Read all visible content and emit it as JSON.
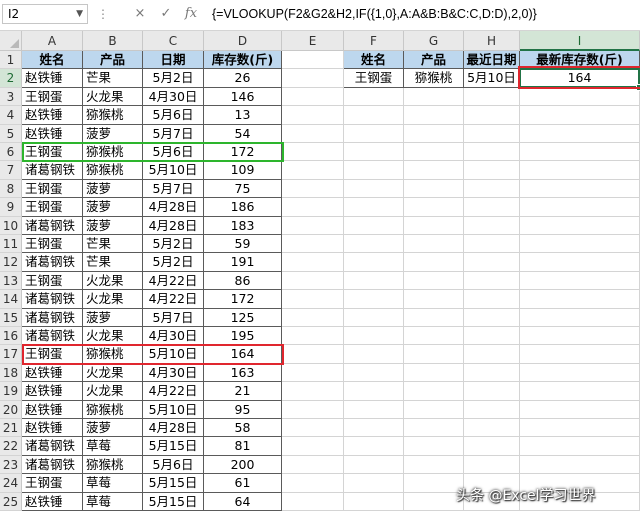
{
  "formula_bar": {
    "name_box": "I2",
    "cancel_icon": "×",
    "enter_icon": "✓",
    "fx_icon": "fx",
    "formula": "{=VLOOKUP(F2&G2&H2,IF({1,0},A:A&B:B&C:C,D:D),2,0)}"
  },
  "columns": [
    "A",
    "B",
    "C",
    "D",
    "E",
    "F",
    "G",
    "H",
    "I"
  ],
  "selected_column": "I",
  "row_numbers": [
    "1",
    "2",
    "3",
    "4",
    "5",
    "6",
    "7",
    "8",
    "9",
    "10",
    "11",
    "12",
    "13",
    "14",
    "15",
    "16",
    "17",
    "18",
    "19",
    "20",
    "21",
    "22",
    "23",
    "24",
    "25"
  ],
  "source_table": {
    "headers": [
      "姓名",
      "产品",
      "日期",
      "库存数(斤)"
    ],
    "rows": [
      [
        "赵铁锤",
        "芒果",
        "5月2日",
        "26"
      ],
      [
        "王钢蛋",
        "火龙果",
        "4月30日",
        "146"
      ],
      [
        "赵铁锤",
        "猕猴桃",
        "5月6日",
        "13"
      ],
      [
        "赵铁锤",
        "菠萝",
        "5月7日",
        "54"
      ],
      [
        "王钢蛋",
        "猕猴桃",
        "5月6日",
        "172"
      ],
      [
        "诸葛钢铁",
        "猕猴桃",
        "5月10日",
        "109"
      ],
      [
        "王钢蛋",
        "菠萝",
        "5月7日",
        "75"
      ],
      [
        "王钢蛋",
        "菠萝",
        "4月28日",
        "186"
      ],
      [
        "诸葛钢铁",
        "菠萝",
        "4月28日",
        "183"
      ],
      [
        "王钢蛋",
        "芒果",
        "5月2日",
        "59"
      ],
      [
        "诸葛钢铁",
        "芒果",
        "5月2日",
        "191"
      ],
      [
        "王钢蛋",
        "火龙果",
        "4月22日",
        "86"
      ],
      [
        "诸葛钢铁",
        "火龙果",
        "4月22日",
        "172"
      ],
      [
        "诸葛钢铁",
        "菠萝",
        "5月7日",
        "125"
      ],
      [
        "诸葛钢铁",
        "火龙果",
        "4月30日",
        "195"
      ],
      [
        "王钢蛋",
        "猕猴桃",
        "5月10日",
        "164"
      ],
      [
        "赵铁锤",
        "火龙果",
        "4月30日",
        "163"
      ],
      [
        "赵铁锤",
        "火龙果",
        "4月22日",
        "21"
      ],
      [
        "赵铁锤",
        "猕猴桃",
        "5月10日",
        "95"
      ],
      [
        "赵铁锤",
        "菠萝",
        "4月28日",
        "58"
      ],
      [
        "诸葛钢铁",
        "草莓",
        "5月15日",
        "81"
      ],
      [
        "诸葛钢铁",
        "猕猴桃",
        "5月6日",
        "200"
      ],
      [
        "王钢蛋",
        "草莓",
        "5月15日",
        "61"
      ],
      [
        "赵铁锤",
        "草莓",
        "5月15日",
        "64"
      ]
    ]
  },
  "lookup_table": {
    "headers": [
      "姓名",
      "产品",
      "最近日期",
      "最新库存数(斤)"
    ],
    "row": [
      "王钢蛋",
      "猕猴桃",
      "5月10日",
      "164"
    ]
  },
  "highlight_colors": {
    "green": "#2db52d",
    "red": "#e0262e",
    "header_fill": "#bdd7ee",
    "excel_green": "#217346"
  },
  "watermark": "头条 @Excel学习世界"
}
